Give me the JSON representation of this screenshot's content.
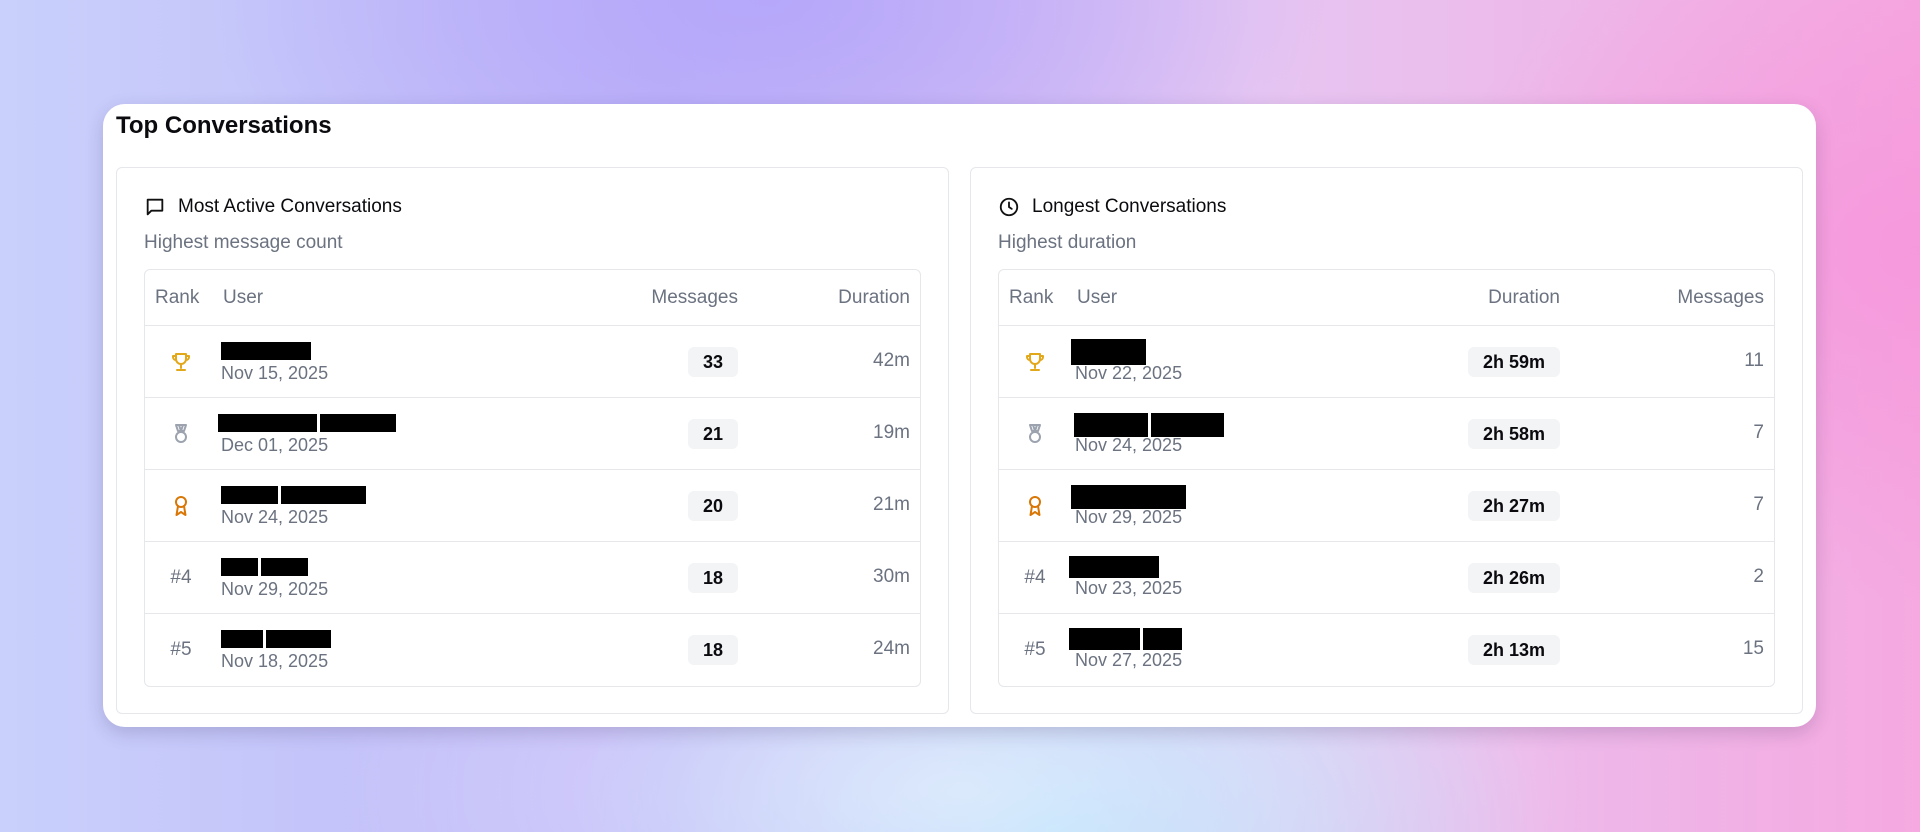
{
  "title": "Top Conversations",
  "colors": {
    "gold": "#e2a81a",
    "silver": "#9ca3af",
    "bronze": "#d97706"
  },
  "panels": {
    "active": {
      "icon": "message-square-icon",
      "title": "Most Active Conversations",
      "subtitle": "Highest message count",
      "headers": {
        "rank": "Rank",
        "user": "User",
        "col3": "Messages",
        "col4": "Duration"
      },
      "rows": [
        {
          "rank_icon": "trophy-icon",
          "rank": "",
          "date": "Nov 15, 2025",
          "col3": "33",
          "col4": "42m"
        },
        {
          "rank_icon": "medal-icon",
          "rank": "",
          "date": "Dec 01, 2025",
          "col3": "21",
          "col4": "19m"
        },
        {
          "rank_icon": "award-icon",
          "rank": "",
          "date": "Nov 24, 2025",
          "col3": "20",
          "col4": "21m"
        },
        {
          "rank_icon": "",
          "rank": "#4",
          "date": "Nov 29, 2025",
          "col3": "18",
          "col4": "30m"
        },
        {
          "rank_icon": "",
          "rank": "#5",
          "date": "Nov 18, 2025",
          "col3": "18",
          "col4": "24m"
        }
      ]
    },
    "longest": {
      "icon": "clock-icon",
      "title": "Longest Conversations",
      "subtitle": "Highest duration",
      "headers": {
        "rank": "Rank",
        "user": "User",
        "col3": "Duration",
        "col4": "Messages"
      },
      "rows": [
        {
          "rank_icon": "trophy-icon",
          "rank": "",
          "date": "Nov 22, 2025",
          "col3": "2h 59m",
          "col4": "11"
        },
        {
          "rank_icon": "medal-icon",
          "rank": "",
          "date": "Nov 24, 2025",
          "col3": "2h 58m",
          "col4": "7"
        },
        {
          "rank_icon": "award-icon",
          "rank": "",
          "date": "Nov 29, 2025",
          "col3": "2h 27m",
          "col4": "7"
        },
        {
          "rank_icon": "",
          "rank": "#4",
          "date": "Nov 23, 2025",
          "col3": "2h 26m",
          "col4": "2"
        },
        {
          "rank_icon": "",
          "rank": "#5",
          "date": "Nov 27, 2025",
          "col3": "2h 13m",
          "col4": "15"
        }
      ]
    }
  }
}
